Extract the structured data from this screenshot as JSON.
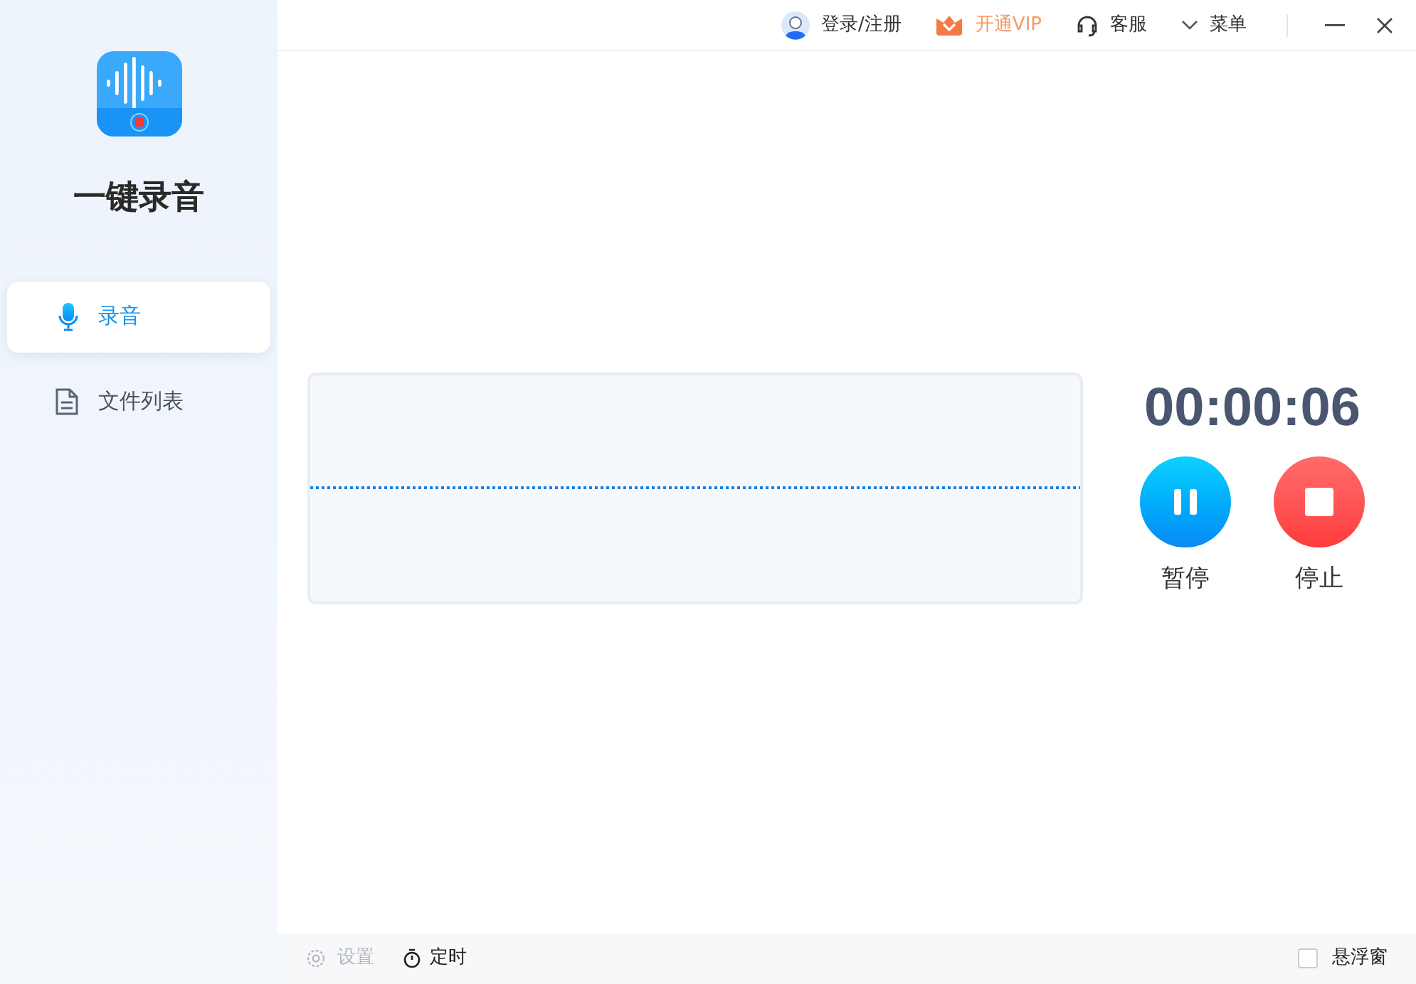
{
  "app": {
    "name": "一键录音"
  },
  "nav": [
    {
      "label": "录音",
      "kind": "mic",
      "selected": true
    },
    {
      "label": "文件列表",
      "kind": "file",
      "selected": false
    }
  ],
  "topbar": [
    {
      "label": "登录/注册",
      "kind": "user"
    },
    {
      "label": "开通VIP",
      "kind": "vip"
    },
    {
      "label": "客服",
      "kind": "headset"
    },
    {
      "label": "菜单",
      "kind": "menu"
    }
  ],
  "recorder": {
    "time": "00:00:06",
    "controls": [
      {
        "label": "暂停",
        "kind": "pause"
      },
      {
        "label": "停止",
        "kind": "stop"
      }
    ]
  },
  "footer": {
    "settings": {
      "label": "设置",
      "disabled": true
    },
    "timer": {
      "label": "定时",
      "disabled": false
    },
    "float_window": {
      "label": "悬浮窗",
      "checked": false
    }
  }
}
